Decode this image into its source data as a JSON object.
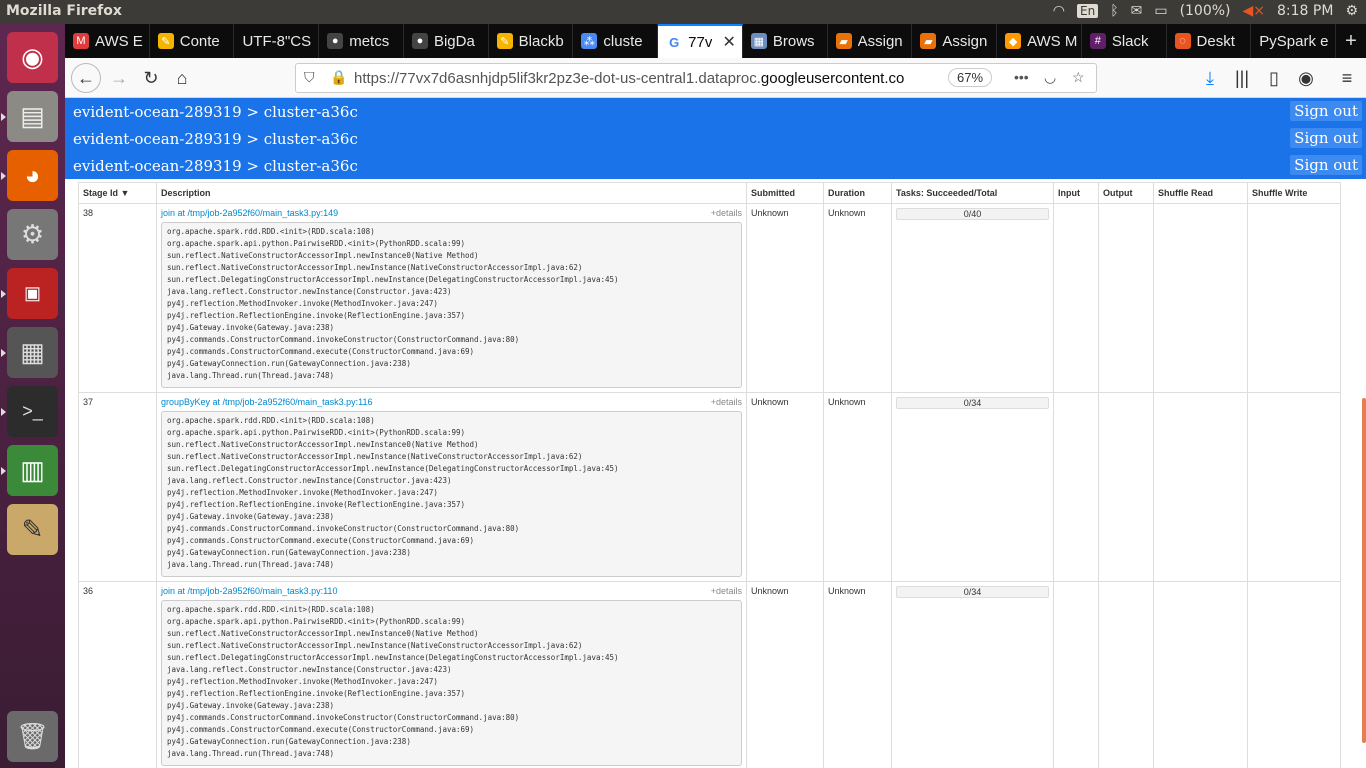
{
  "system_bar": {
    "app_title": "Mozilla Firefox",
    "keyboard": "En",
    "battery": "(100%)",
    "clock": "8:18 PM"
  },
  "tabs": [
    {
      "label": "AWS E",
      "icon": "aws-tab-icon",
      "color": "#e03c3c"
    },
    {
      "label": "Conte",
      "icon": "edit-tab-icon",
      "color": "#f4b400"
    },
    {
      "label": "UTF-8\"CS",
      "icon": "blank-tab-icon",
      "color": "#666666"
    },
    {
      "label": "metcs",
      "icon": "github-tab-icon",
      "color": "#444444"
    },
    {
      "label": "BigDa",
      "icon": "github-tab-icon",
      "color": "#444444"
    },
    {
      "label": "Blackb",
      "icon": "edit-tab-icon",
      "color": "#f4b400"
    },
    {
      "label": "cluste",
      "icon": "dataproc-tab-icon",
      "color": "#4a8af4"
    },
    {
      "label": "77v",
      "icon": "google-tab-icon",
      "color": "#4285f4",
      "active": true
    },
    {
      "label": "Brows",
      "icon": "grid-tab-icon",
      "color": "#6c8ebf"
    },
    {
      "label": "Assign",
      "icon": "book-tab-icon",
      "color": "#e8710a"
    },
    {
      "label": "Assign",
      "icon": "book-tab-icon",
      "color": "#e8710a"
    },
    {
      "label": "AWS M",
      "icon": "aws-box-tab-icon",
      "color": "#ff9900"
    },
    {
      "label": "Slack",
      "icon": "slack-tab-icon",
      "color": "#611f69"
    },
    {
      "label": "Deskt",
      "icon": "ubuntu-tab-icon",
      "color": "#e95420"
    },
    {
      "label": "PySpark e",
      "icon": "blank-tab-icon",
      "color": "#666666"
    }
  ],
  "navbar": {
    "url_prefix": "https://77vx7d6asnhjdp5lif3kr2pz3e-dot-us-central1.dataproc.",
    "url_domain": "googleusercontent.co",
    "zoom": "67%"
  },
  "page": {
    "breadcrumb": "evident-ocean-289319  >  cluster-a36c",
    "sign_out": "Sign out",
    "columns": [
      "Stage Id",
      "Description",
      "Submitted",
      "Duration",
      "Tasks: Succeeded/Total",
      "Input",
      "Output",
      "Shuffle Read",
      "Shuffle Write"
    ],
    "sort_indicator": "▼",
    "details_label": "+details",
    "stages": [
      {
        "id": "38",
        "description": "join at /tmp/job-2a952f60/main_task3.py:149",
        "submitted": "Unknown",
        "duration": "Unknown",
        "tasks": "0/40",
        "progress": 0,
        "stack": "org.apache.spark.rdd.RDD.<init>(RDD.scala:108)\norg.apache.spark.api.python.PairwiseRDD.<init>(PythonRDD.scala:99)\nsun.reflect.NativeConstructorAccessorImpl.newInstance0(Native Method)\nsun.reflect.NativeConstructorAccessorImpl.newInstance(NativeConstructorAccessorImpl.java:62)\nsun.reflect.DelegatingConstructorAccessorImpl.newInstance(DelegatingConstructorAccessorImpl.java:45)\njava.lang.reflect.Constructor.newInstance(Constructor.java:423)\npy4j.reflection.MethodInvoker.invoke(MethodInvoker.java:247)\npy4j.reflection.ReflectionEngine.invoke(ReflectionEngine.java:357)\npy4j.Gateway.invoke(Gateway.java:238)\npy4j.commands.ConstructorCommand.invokeConstructor(ConstructorCommand.java:80)\npy4j.commands.ConstructorCommand.execute(ConstructorCommand.java:69)\npy4j.GatewayConnection.run(GatewayConnection.java:238)\njava.lang.Thread.run(Thread.java:748)"
      },
      {
        "id": "37",
        "description": "groupByKey at /tmp/job-2a952f60/main_task3.py:116",
        "submitted": "Unknown",
        "duration": "Unknown",
        "tasks": "0/34",
        "progress": 0,
        "stack": "org.apache.spark.rdd.RDD.<init>(RDD.scala:108)\norg.apache.spark.api.python.PairwiseRDD.<init>(PythonRDD.scala:99)\nsun.reflect.NativeConstructorAccessorImpl.newInstance0(Native Method)\nsun.reflect.NativeConstructorAccessorImpl.newInstance(NativeConstructorAccessorImpl.java:62)\nsun.reflect.DelegatingConstructorAccessorImpl.newInstance(DelegatingConstructorAccessorImpl.java:45)\njava.lang.reflect.Constructor.newInstance(Constructor.java:423)\npy4j.reflection.MethodInvoker.invoke(MethodInvoker.java:247)\npy4j.reflection.ReflectionEngine.invoke(ReflectionEngine.java:357)\npy4j.Gateway.invoke(Gateway.java:238)\npy4j.commands.ConstructorCommand.invokeConstructor(ConstructorCommand.java:80)\npy4j.commands.ConstructorCommand.execute(ConstructorCommand.java:69)\npy4j.GatewayConnection.run(GatewayConnection.java:238)\njava.lang.Thread.run(Thread.java:748)"
      },
      {
        "id": "36",
        "description": "join at /tmp/job-2a952f60/main_task3.py:110",
        "submitted": "Unknown",
        "duration": "Unknown",
        "tasks": "0/34",
        "progress": 0,
        "stack": "org.apache.spark.rdd.RDD.<init>(RDD.scala:108)\norg.apache.spark.api.python.PairwiseRDD.<init>(PythonRDD.scala:99)\nsun.reflect.NativeConstructorAccessorImpl.newInstance0(Native Method)\nsun.reflect.NativeConstructorAccessorImpl.newInstance(NativeConstructorAccessorImpl.java:62)\nsun.reflect.DelegatingConstructorAccessorImpl.newInstance(DelegatingConstructorAccessorImpl.java:45)\njava.lang.reflect.Constructor.newInstance(Constructor.java:423)\npy4j.reflection.MethodInvoker.invoke(MethodInvoker.java:247)\npy4j.reflection.ReflectionEngine.invoke(ReflectionEngine.java:357)\npy4j.Gateway.invoke(Gateway.java:238)\npy4j.commands.ConstructorCommand.invokeConstructor(ConstructorCommand.java:80)\npy4j.commands.ConstructorCommand.execute(ConstructorCommand.java:69)\npy4j.GatewayConnection.run(GatewayConnection.java:238)\njava.lang.Thread.run(Thread.java:748)"
      }
    ]
  }
}
